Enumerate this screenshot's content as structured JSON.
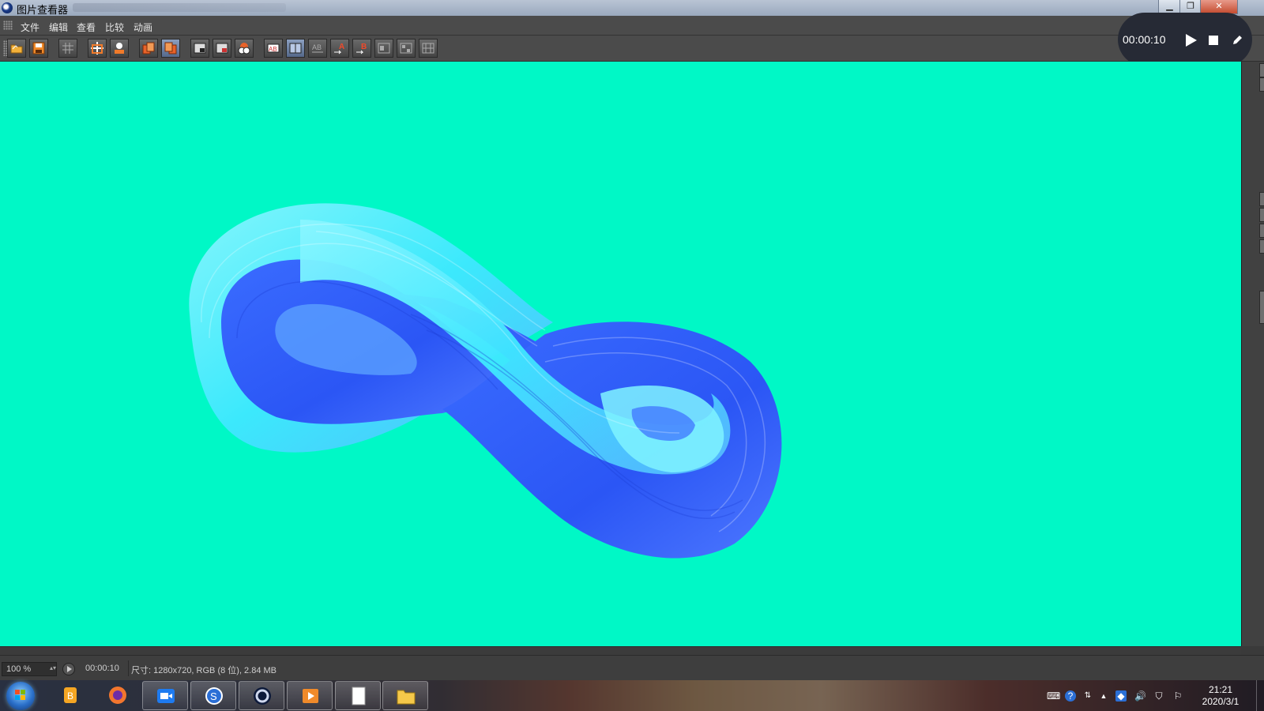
{
  "window": {
    "title": "图片查看器",
    "buttons": [
      "minimize",
      "restore",
      "close"
    ]
  },
  "menu": {
    "items": [
      "文件",
      "编辑",
      "查看",
      "比较",
      "动画"
    ]
  },
  "toolbar": {
    "groups": [
      [
        "open-icon",
        "save-icon"
      ],
      [
        "grid-icon"
      ],
      [
        "crosshair-icon",
        "stamp-icon"
      ],
      [
        "copy-left-icon",
        "copy-right-icon"
      ],
      [
        "view-a-icon",
        "view-b-icon",
        "view-filter-icon"
      ],
      [
        "ab-icon",
        "ab-split-icon",
        "ab-text-icon",
        "a-arrow-icon",
        "b-arrow-icon"
      ],
      [
        "layout-1-icon",
        "layout-2-icon",
        "layout-3-icon"
      ]
    ],
    "active": [
      "copy-right-icon",
      "ab-split-icon"
    ]
  },
  "recorder": {
    "time": "00:00:10",
    "controls": [
      "play-icon",
      "stop-icon",
      "pen-icon"
    ]
  },
  "canvas": {
    "background": "#00f8c6",
    "image": "blue infinity ribbon"
  },
  "status": {
    "zoom": "100 %",
    "time": "00:00:10",
    "info": "尺寸: 1280x720, RGB (8 位), 2.84 MB"
  },
  "taskbar": {
    "apps": [
      "start-orb",
      "coins-app",
      "firefox",
      "video-meeting",
      "sogou-input",
      "cinema4d",
      "media-player",
      "notepad",
      "file-explorer"
    ],
    "tray": [
      "keyboard-icon",
      "help-icon",
      "network-icon",
      "arrow-up-icon",
      "shield-icon",
      "volume-icon",
      "security-icon",
      "action-center-icon"
    ],
    "clock_time": "21:21",
    "clock_date": "2020/3/1"
  }
}
